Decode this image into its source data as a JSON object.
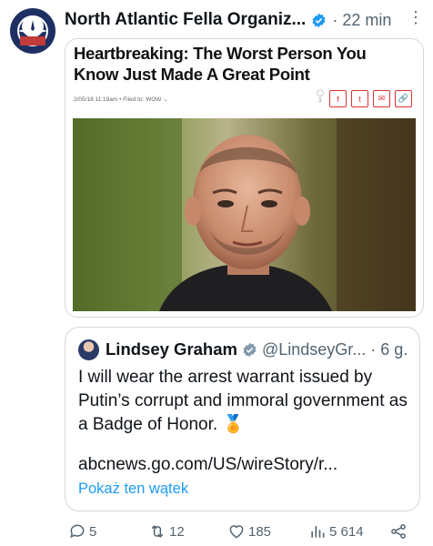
{
  "post": {
    "author": "North Atlantic Fella Organiz...",
    "time": "· 22 min",
    "more": "···"
  },
  "article": {
    "title": "Heartbreaking: The Worst Person You Know Just Made A Great Point",
    "byline": "2/05/18 11:19am  •  Filed to: WOW ⌄",
    "comment_count": "1",
    "share_icons": [
      "f",
      "t",
      "✉",
      "🔗"
    ]
  },
  "quote": {
    "name": "Lindsey Graham",
    "handle": "@LindseyGr...",
    "time": "· 6 g.",
    "text": "I will wear the arrest warrant issued by Putin’s corrupt and immoral government as a Badge of Honor. 🏅",
    "link": "abcnews.go.com/US/wireStory/r...",
    "thread_label": "Pokaż ten wątek"
  },
  "actions": {
    "replies": "5",
    "reposts": "12",
    "likes": "185",
    "views": "5 614"
  },
  "colors": {
    "accent": "#1d9bf0",
    "muted": "#536471",
    "text": "#0f1419"
  },
  "icons": [
    "compass-logo-icon",
    "verified-badge-icon",
    "more-icon",
    "reply-icon",
    "repost-icon",
    "like-icon",
    "views-icon",
    "share-icon"
  ]
}
